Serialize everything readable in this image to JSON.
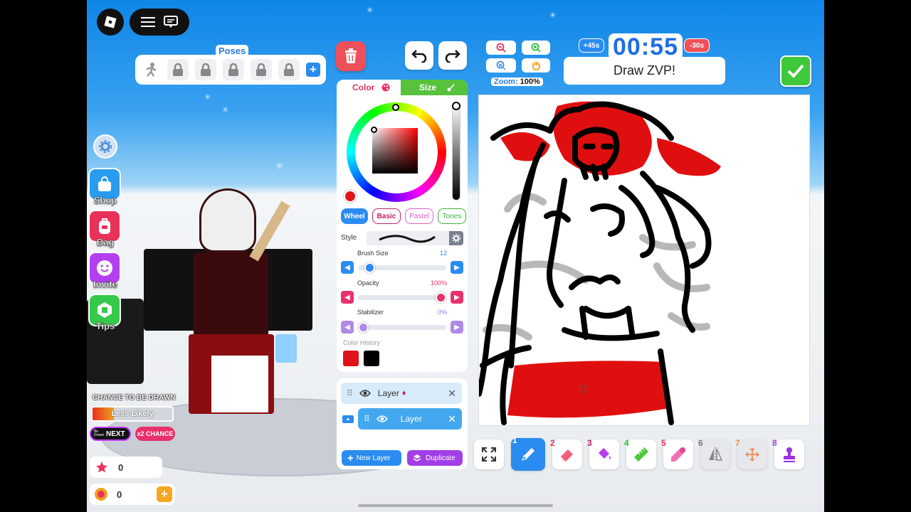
{
  "poses": {
    "title": "Poses",
    "add_label": "+"
  },
  "timer": {
    "bonus_plus": "+45s",
    "time": "00:55",
    "bonus_minus": "-30s",
    "prompt": "Draw ZVP!"
  },
  "zoom": {
    "label": "Zoom:",
    "value": "100%"
  },
  "side_buttons": [
    {
      "label": "Shop",
      "color": "#2a9cf0"
    },
    {
      "label": "Bag",
      "color": "#e8325a"
    },
    {
      "label": "Invite",
      "color": "#b43ff0"
    },
    {
      "label": "Tips",
      "color": "#34c94a"
    }
  ],
  "chance": {
    "title": "CHANCE TO BE DRAWN",
    "level": "Less Likely",
    "next_small": "Be Drawn",
    "next_label": "NEXT",
    "double_label": "x2 CHANCE"
  },
  "stats": {
    "stars": "0",
    "coins": "0",
    "add_coins": "+"
  },
  "color_panel": {
    "tab_color": "Color",
    "tab_size": "Size",
    "current_color": "#e0121a",
    "modes": [
      "Wheel",
      "Basic",
      "Pastel",
      "Tones"
    ],
    "style_label": "Style",
    "brush_size_label": "Brush Size",
    "brush_size_value": "12",
    "brush_size_fraction": 0.08,
    "opacity_label": "Opacity",
    "opacity_value": "100%",
    "opacity_fraction": 1.0,
    "stabilizer_label": "Stabilizer",
    "stabilizer_value": "0%",
    "stabilizer_fraction": 0,
    "history_label": "Color History",
    "history": [
      "#e0121a",
      "#000000"
    ]
  },
  "layers": {
    "items": [
      {
        "name": "Layer"
      },
      {
        "name": "Layer"
      }
    ],
    "new_layer": "New Layer",
    "duplicate": "Duplicate"
  },
  "tools": [
    {
      "num": "",
      "name": "fullscreen"
    },
    {
      "num": "1",
      "name": "pencil",
      "active": true
    },
    {
      "num": "2",
      "name": "eraser"
    },
    {
      "num": "3",
      "name": "fill"
    },
    {
      "num": "4",
      "name": "ruler"
    },
    {
      "num": "5",
      "name": "eyedropper"
    },
    {
      "num": "6",
      "name": "mirror"
    },
    {
      "num": "7",
      "name": "move"
    },
    {
      "num": "8",
      "name": "stamp"
    }
  ]
}
